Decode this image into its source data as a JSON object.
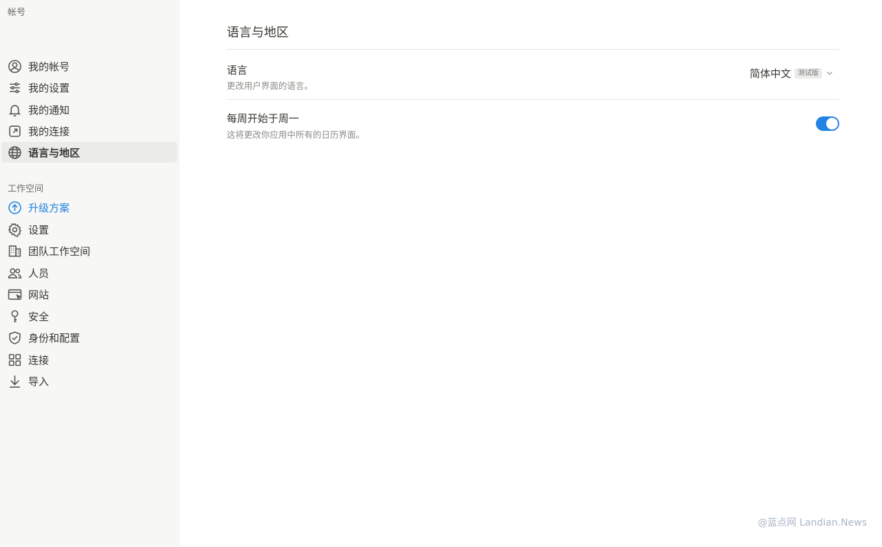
{
  "sidebar": {
    "account_section_label": "帐号",
    "account_items": [
      {
        "label": "我的帐号",
        "icon": "user-circle-icon"
      },
      {
        "label": "我的设置",
        "icon": "sliders-icon"
      },
      {
        "label": "我的通知",
        "icon": "bell-icon"
      },
      {
        "label": "我的连接",
        "icon": "external-link-icon"
      },
      {
        "label": "语言与地区",
        "icon": "globe-icon",
        "active": true
      }
    ],
    "workspace_section_label": "工作空间",
    "workspace_items": [
      {
        "label": "升级方案",
        "icon": "arrow-up-circle-icon",
        "accent": true
      },
      {
        "label": "设置",
        "icon": "gear-icon"
      },
      {
        "label": "团队工作空间",
        "icon": "building-icon"
      },
      {
        "label": "人员",
        "icon": "people-icon"
      },
      {
        "label": "网站",
        "icon": "browser-window-icon"
      },
      {
        "label": "安全",
        "icon": "key-icon"
      },
      {
        "label": "身份和配置",
        "icon": "shield-check-icon"
      },
      {
        "label": "连接",
        "icon": "grid-icon"
      },
      {
        "label": "导入",
        "icon": "download-arrow-icon"
      }
    ]
  },
  "main": {
    "title": "语言与地区",
    "language": {
      "title": "语言",
      "description": "更改用户界面的语言。",
      "selected_value": "简体中文",
      "badge": "测试版"
    },
    "week_start": {
      "title": "每周开始于周一",
      "description": "这将更改你应用中所有的日历界面。",
      "enabled": true
    }
  },
  "watermark": "@蓝点网 Landian.News",
  "colors": {
    "accent": "#2383e2",
    "sidebar_bg": "#f7f7f5",
    "active_item_bg": "#ebebea"
  }
}
